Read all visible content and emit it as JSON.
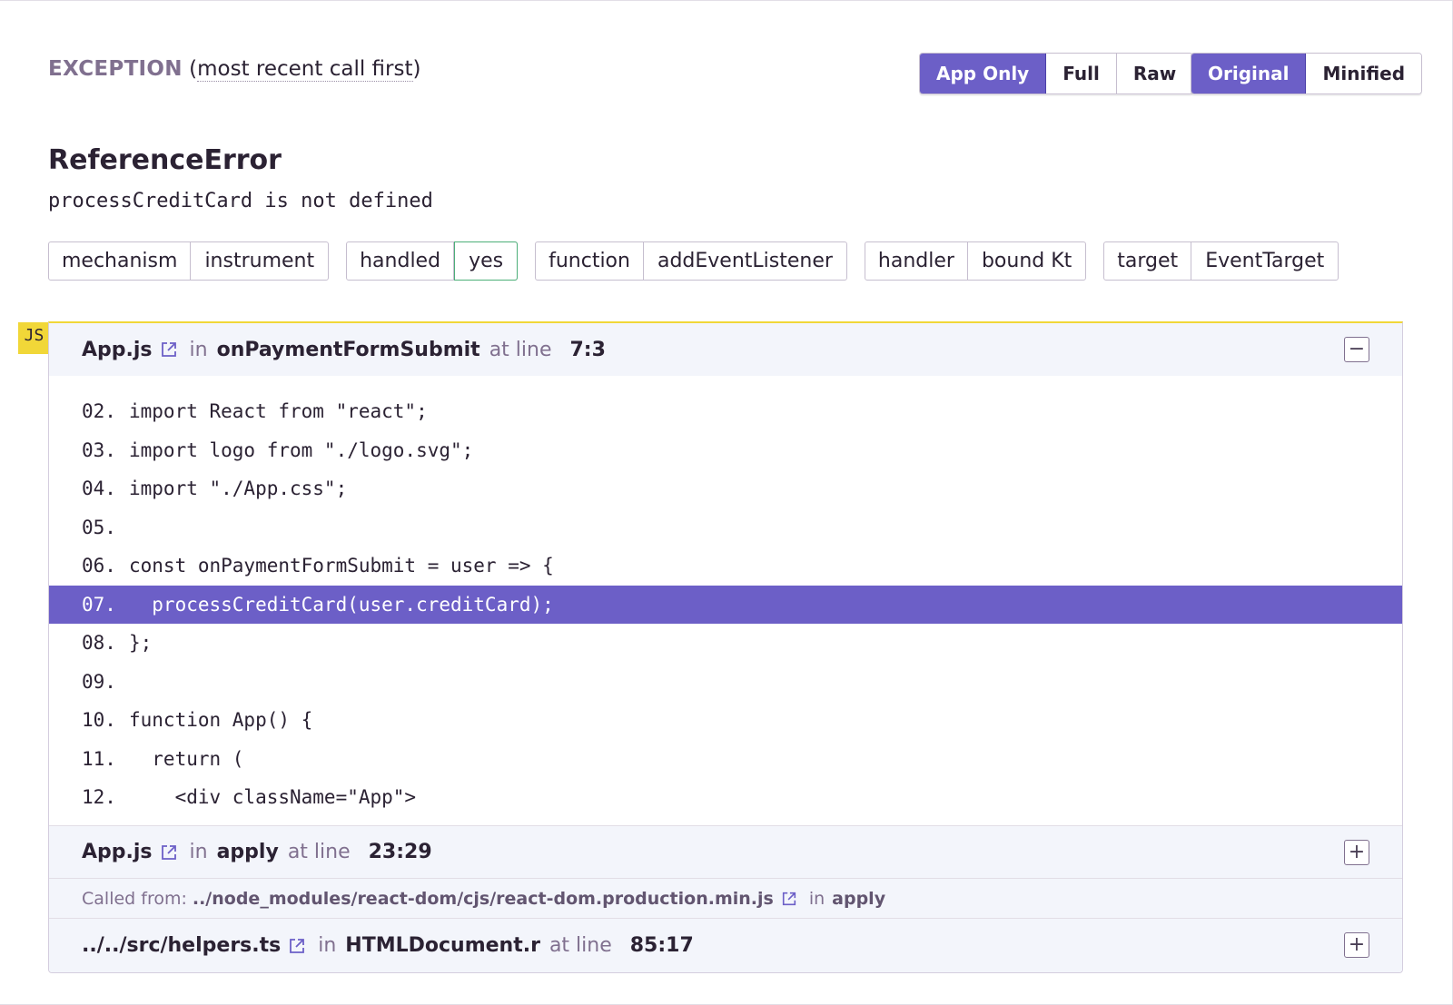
{
  "exception_header": {
    "label": "EXCEPTION",
    "subtitle": "most recent call first"
  },
  "view_toggle": {
    "app_only": "App Only",
    "full": "Full",
    "raw": "Raw",
    "selected": "App Only"
  },
  "source_toggle": {
    "original": "Original",
    "minified": "Minified",
    "selected": "Original"
  },
  "error": {
    "type": "ReferenceError",
    "message": "processCreditCard is not defined"
  },
  "tags": [
    {
      "key": "mechanism",
      "value": "instrument"
    },
    {
      "key": "handled",
      "value": "yes"
    },
    {
      "key": "function",
      "value": "addEventListener"
    },
    {
      "key": "handler",
      "value": "bound Kt"
    },
    {
      "key": "target",
      "value": "EventTarget"
    }
  ],
  "platform_badge": "JS",
  "frames": [
    {
      "file": "App.js",
      "in": "in",
      "function": "onPaymentFormSubmit",
      "at_line": "at line",
      "position": "7:3",
      "expanded": true,
      "toggle": "−",
      "lines": [
        {
          "num": "02.",
          "code": "import React from \"react\";"
        },
        {
          "num": "03.",
          "code": "import logo from \"./logo.svg\";"
        },
        {
          "num": "04.",
          "code": "import \"./App.css\";"
        },
        {
          "num": "05.",
          "code": ""
        },
        {
          "num": "06.",
          "code": "const onPaymentFormSubmit = user => {"
        },
        {
          "num": "07.",
          "code": "  processCreditCard(user.creditCard);"
        },
        {
          "num": "08.",
          "code": "};"
        },
        {
          "num": "09.",
          "code": ""
        },
        {
          "num": "10.",
          "code": "function App() {"
        },
        {
          "num": "11.",
          "code": "  return ("
        },
        {
          "num": "12.",
          "code": "    <div className=\"App\">"
        }
      ],
      "active_line": "07."
    },
    {
      "file": "App.js",
      "in": "in",
      "function": "apply",
      "at_line": "at line",
      "position": "23:29",
      "expanded": false,
      "toggle": "+",
      "called_from": {
        "label": "Called from:",
        "path": "../node_modules/react-dom/cjs/react-dom.production.min.js",
        "in": "in",
        "function": "apply"
      }
    },
    {
      "file": "../../src/helpers.ts",
      "in": "in",
      "function": "HTMLDocument.r",
      "at_line": "at line",
      "position": "85:17",
      "expanded": false,
      "toggle": "+"
    }
  ],
  "colors": {
    "accent": "#6c5fc7",
    "badge_yellow": "#f1d738",
    "handled_green": "#4caf78"
  },
  "icons": {
    "external_link": "external-link-icon",
    "collapse": "minus-icon",
    "expand": "plus-icon"
  }
}
